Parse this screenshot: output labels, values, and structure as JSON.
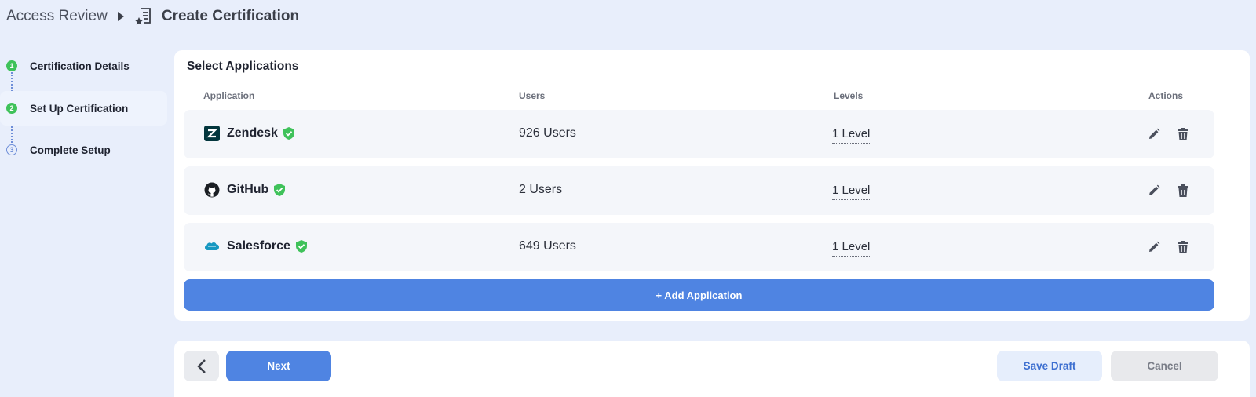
{
  "breadcrumb": {
    "root": "Access Review",
    "current": "Create Certification",
    "arrow_icon": "caret-right-icon",
    "current_icon": "certificate-icon"
  },
  "stepper": {
    "steps": [
      {
        "number": "1",
        "label": "Certification Details",
        "state": "done"
      },
      {
        "number": "2",
        "label": "Set Up Certification",
        "state": "active"
      },
      {
        "number": "3",
        "label": "Complete Setup",
        "state": "pending"
      }
    ]
  },
  "card": {
    "title": "Select Applications",
    "columns": {
      "application": "Application",
      "users": "Users",
      "levels": "Levels",
      "actions": "Actions"
    },
    "applications": [
      {
        "name": "Zendesk",
        "users": "926 Users",
        "level": "1 Level",
        "logo": "zendesk-logo"
      },
      {
        "name": "GitHub",
        "users": "2 Users",
        "level": "1 Level",
        "logo": "github-logo"
      },
      {
        "name": "Salesforce",
        "users": "649 Users",
        "level": "1 Level",
        "logo": "salesforce-logo"
      }
    ],
    "add_button": "+ Add Application"
  },
  "footer": {
    "next": "Next",
    "save_draft": "Save Draft",
    "cancel": "Cancel",
    "back_icon": "chevron-left-icon"
  },
  "colors": {
    "page_bg": "#e8eefb",
    "primary": "#4f84e2",
    "step_done": "#3fc25a",
    "verified": "#3fc25a"
  }
}
